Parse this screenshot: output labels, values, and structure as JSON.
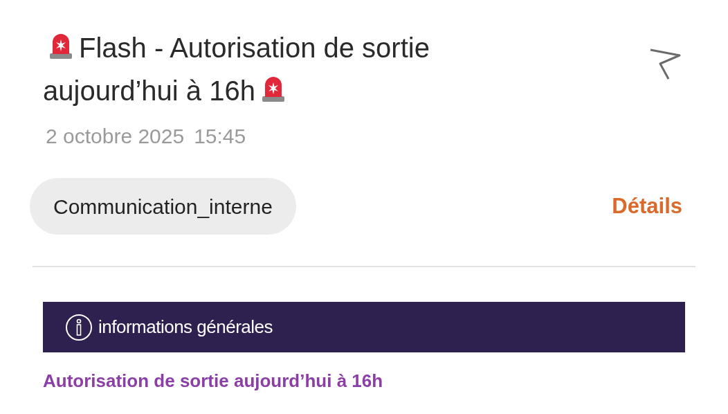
{
  "header": {
    "title": "Flash - Autorisation de sortie aujourd’hui à 16h",
    "date": "2 octobre 2025",
    "time": "15:45"
  },
  "tag": {
    "label": "Communication_interne"
  },
  "details_link": "Détails",
  "section": {
    "title": "informations générales"
  },
  "body": {
    "heading": "Autorisation de sortie aujourd’hui à 16h"
  }
}
